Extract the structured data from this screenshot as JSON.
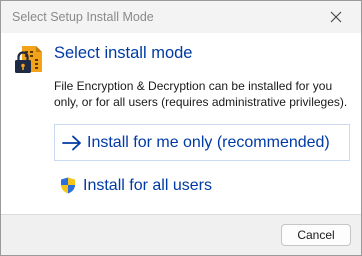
{
  "window": {
    "title": "Select Setup Install Mode",
    "close_icon": "close-icon"
  },
  "header": {
    "app_icon": "folder-lock-icon",
    "heading": "Select install mode"
  },
  "description": "File Encryption & Decryption can be installed for you only, or for all users (requires administrative privileges).",
  "options": [
    {
      "icon": "arrow-right-icon",
      "label": "Install for me only (recommended)"
    },
    {
      "icon": "uac-shield-icon",
      "label": "Install for all users"
    }
  ],
  "footer": {
    "cancel_label": "Cancel"
  },
  "colors": {
    "link_blue": "#003aa5",
    "titlebar": "#f3f3f3",
    "footer": "#f0f0f0"
  }
}
